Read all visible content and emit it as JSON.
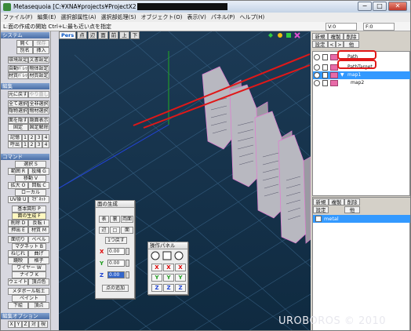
{
  "window": {
    "title": "Metasequoia [C:¥XNA¥projects¥ProjectX2",
    "minimize": "−",
    "maximize": "□",
    "close": "✕"
  },
  "menu": [
    "ファイル(F)",
    "編集(E)",
    "選択部属性(A)",
    "選択部処理(S)",
    "オブジェクト(O)",
    "表示(V)",
    "パネル(P)",
    "ヘルプ(H)"
  ],
  "status": {
    "hint": "L:面の作成の開始  Ctrl+L:最も近い点を指定",
    "v": "V:0",
    "f": "F:0"
  },
  "left": {
    "system_label": "システム",
    "open": "開く",
    "save": "保存",
    "saveas": "別名",
    "insert": "挿入",
    "env": "環境設定",
    "docset": "文書設定",
    "autopal": "自動ﾊﾟﾚｯﾄ",
    "objset": "物体設定",
    "matpal": "材質ﾊﾟﾚｯﾄ",
    "matset": "材質設定",
    "edit_label": "編集",
    "undo": "元に戻す",
    "redo": "やり直し",
    "selall": "全て選択",
    "selnone": "全非選択",
    "hidesel": "隠物選択",
    "matsel": "物材選択",
    "hidesurf": "面を隠す",
    "showhidden": "隠面表示",
    "fix": "固定",
    "unfix": "固定解除",
    "memory": "記憶",
    "m1": "1",
    "m2": "2",
    "m3": "3",
    "m4": "4",
    "recall": "呼出",
    "r1": "1",
    "r2": "2",
    "r3": "3",
    "r4": "4",
    "command_label": "コマンド",
    "select": "選択 S",
    "range": "範囲 R",
    "lasso": "投縄 G",
    "move": "移動 V",
    "scale": "拡大 O",
    "rotate": "回転 C",
    "local": "ローカル",
    "uv": "UV操 U",
    "magnet": "ﾏｸﾞﾈｯﾄ",
    "basic": "基本図形 P",
    "facegen": "面の生成 F",
    "delete": "削除 D",
    "knife": "反転 I",
    "extrude": "押出 E",
    "material": "材質 M",
    "cut": "面切り",
    "bevel": "ベベル",
    "magnet2": "マグネット B",
    "twist": "ねじれ",
    "bend": "曲げ",
    "warp": "鏡映",
    "grid": "格子",
    "wire": "ワイヤー W",
    "knifeK": "ナイフ K",
    "weight": "ウェイト",
    "vcolor": "頂点色",
    "metaball": "メタボール粘土",
    "paint": "ペイント",
    "drawing": "下絵",
    "paint2": "頂点",
    "edit_option_label": "編集オプション",
    "ox": "X",
    "oy": "Y",
    "oz": "Z",
    "osym": "対",
    "oview": "視"
  },
  "viewport": {
    "persp": "Pers",
    "point": "点",
    "edge": "辺",
    "face": "面",
    "front": "前",
    "top": "上",
    "bottom": "下"
  },
  "right": {
    "new": "新規",
    "copy": "複製",
    "del": "削除",
    "settings": "設定",
    "lt": "<",
    "gt": ">",
    "other": "他",
    "objects": [
      {
        "name": "Path",
        "exp": ""
      },
      {
        "name": "PathTarget",
        "exp": ""
      },
      {
        "name": "map1",
        "exp": "▼"
      },
      {
        "name": "map2",
        "exp": ""
      }
    ],
    "mat_new": "新規",
    "mat_copy": "複製",
    "mat_del": "削除",
    "mat_settings": "設定",
    "mat_other": "他",
    "material_name": "metal"
  },
  "facegen": {
    "title": "面の生成",
    "front": "表",
    "back": "裏",
    "both": "両面",
    "edge": "辺",
    "quad": "□",
    "poly": "面",
    "undo1": "1つ戻す",
    "x_lbl": "X",
    "y_lbl": "Y",
    "z_lbl": "Z",
    "x_val": "0.00",
    "y_val": "0.00",
    "z_val": "0.00",
    "addpoint": "点の追加"
  },
  "oppanel": {
    "title": "操作パネル",
    "x": "X",
    "y": "Y",
    "z": "Z"
  },
  "watermark": "UROBOROS © 2010"
}
